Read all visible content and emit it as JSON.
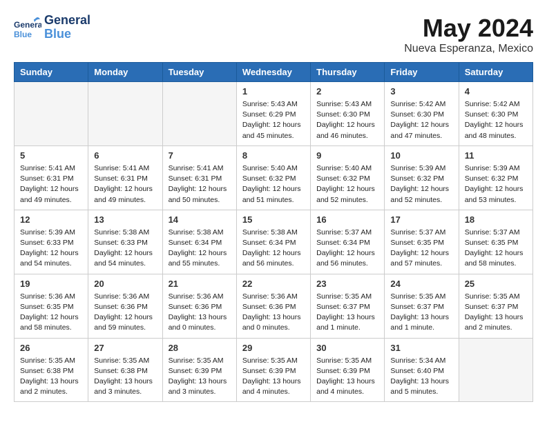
{
  "header": {
    "logo_general": "General",
    "logo_blue": "Blue",
    "month_title": "May 2024",
    "location": "Nueva Esperanza, Mexico"
  },
  "weekdays": [
    "Sunday",
    "Monday",
    "Tuesday",
    "Wednesday",
    "Thursday",
    "Friday",
    "Saturday"
  ],
  "weeks": [
    [
      {
        "day": "",
        "info": "",
        "empty": true
      },
      {
        "day": "",
        "info": "",
        "empty": true
      },
      {
        "day": "",
        "info": "",
        "empty": true
      },
      {
        "day": "1",
        "info": "Sunrise: 5:43 AM\nSunset: 6:29 PM\nDaylight: 12 hours\nand 45 minutes."
      },
      {
        "day": "2",
        "info": "Sunrise: 5:43 AM\nSunset: 6:30 PM\nDaylight: 12 hours\nand 46 minutes."
      },
      {
        "day": "3",
        "info": "Sunrise: 5:42 AM\nSunset: 6:30 PM\nDaylight: 12 hours\nand 47 minutes."
      },
      {
        "day": "4",
        "info": "Sunrise: 5:42 AM\nSunset: 6:30 PM\nDaylight: 12 hours\nand 48 minutes."
      }
    ],
    [
      {
        "day": "5",
        "info": "Sunrise: 5:41 AM\nSunset: 6:31 PM\nDaylight: 12 hours\nand 49 minutes."
      },
      {
        "day": "6",
        "info": "Sunrise: 5:41 AM\nSunset: 6:31 PM\nDaylight: 12 hours\nand 49 minutes."
      },
      {
        "day": "7",
        "info": "Sunrise: 5:41 AM\nSunset: 6:31 PM\nDaylight: 12 hours\nand 50 minutes."
      },
      {
        "day": "8",
        "info": "Sunrise: 5:40 AM\nSunset: 6:32 PM\nDaylight: 12 hours\nand 51 minutes."
      },
      {
        "day": "9",
        "info": "Sunrise: 5:40 AM\nSunset: 6:32 PM\nDaylight: 12 hours\nand 52 minutes."
      },
      {
        "day": "10",
        "info": "Sunrise: 5:39 AM\nSunset: 6:32 PM\nDaylight: 12 hours\nand 52 minutes."
      },
      {
        "day": "11",
        "info": "Sunrise: 5:39 AM\nSunset: 6:32 PM\nDaylight: 12 hours\nand 53 minutes."
      }
    ],
    [
      {
        "day": "12",
        "info": "Sunrise: 5:39 AM\nSunset: 6:33 PM\nDaylight: 12 hours\nand 54 minutes."
      },
      {
        "day": "13",
        "info": "Sunrise: 5:38 AM\nSunset: 6:33 PM\nDaylight: 12 hours\nand 54 minutes."
      },
      {
        "day": "14",
        "info": "Sunrise: 5:38 AM\nSunset: 6:34 PM\nDaylight: 12 hours\nand 55 minutes."
      },
      {
        "day": "15",
        "info": "Sunrise: 5:38 AM\nSunset: 6:34 PM\nDaylight: 12 hours\nand 56 minutes."
      },
      {
        "day": "16",
        "info": "Sunrise: 5:37 AM\nSunset: 6:34 PM\nDaylight: 12 hours\nand 56 minutes."
      },
      {
        "day": "17",
        "info": "Sunrise: 5:37 AM\nSunset: 6:35 PM\nDaylight: 12 hours\nand 57 minutes."
      },
      {
        "day": "18",
        "info": "Sunrise: 5:37 AM\nSunset: 6:35 PM\nDaylight: 12 hours\nand 58 minutes."
      }
    ],
    [
      {
        "day": "19",
        "info": "Sunrise: 5:36 AM\nSunset: 6:35 PM\nDaylight: 12 hours\nand 58 minutes."
      },
      {
        "day": "20",
        "info": "Sunrise: 5:36 AM\nSunset: 6:36 PM\nDaylight: 12 hours\nand 59 minutes."
      },
      {
        "day": "21",
        "info": "Sunrise: 5:36 AM\nSunset: 6:36 PM\nDaylight: 13 hours\nand 0 minutes."
      },
      {
        "day": "22",
        "info": "Sunrise: 5:36 AM\nSunset: 6:36 PM\nDaylight: 13 hours\nand 0 minutes."
      },
      {
        "day": "23",
        "info": "Sunrise: 5:35 AM\nSunset: 6:37 PM\nDaylight: 13 hours\nand 1 minute."
      },
      {
        "day": "24",
        "info": "Sunrise: 5:35 AM\nSunset: 6:37 PM\nDaylight: 13 hours\nand 1 minute."
      },
      {
        "day": "25",
        "info": "Sunrise: 5:35 AM\nSunset: 6:37 PM\nDaylight: 13 hours\nand 2 minutes."
      }
    ],
    [
      {
        "day": "26",
        "info": "Sunrise: 5:35 AM\nSunset: 6:38 PM\nDaylight: 13 hours\nand 2 minutes."
      },
      {
        "day": "27",
        "info": "Sunrise: 5:35 AM\nSunset: 6:38 PM\nDaylight: 13 hours\nand 3 minutes."
      },
      {
        "day": "28",
        "info": "Sunrise: 5:35 AM\nSunset: 6:39 PM\nDaylight: 13 hours\nand 3 minutes."
      },
      {
        "day": "29",
        "info": "Sunrise: 5:35 AM\nSunset: 6:39 PM\nDaylight: 13 hours\nand 4 minutes."
      },
      {
        "day": "30",
        "info": "Sunrise: 5:35 AM\nSunset: 6:39 PM\nDaylight: 13 hours\nand 4 minutes."
      },
      {
        "day": "31",
        "info": "Sunrise: 5:34 AM\nSunset: 6:40 PM\nDaylight: 13 hours\nand 5 minutes."
      },
      {
        "day": "",
        "info": "",
        "empty": true
      }
    ]
  ]
}
